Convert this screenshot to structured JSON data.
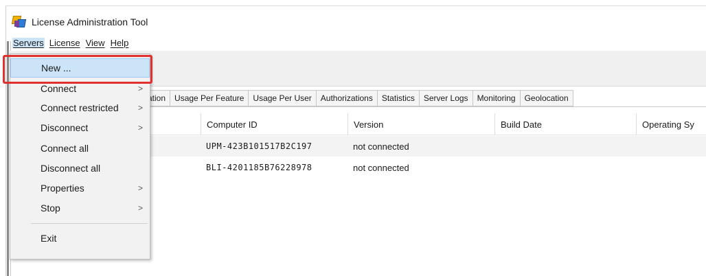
{
  "window": {
    "title": "License Administration Tool"
  },
  "menubar": {
    "items": [
      {
        "label": "Servers",
        "active": true
      },
      {
        "label": "License"
      },
      {
        "label": "View"
      },
      {
        "label": "Help"
      }
    ]
  },
  "servers_menu": {
    "items": [
      {
        "label": "New ...",
        "highlighted": true,
        "submenu": false
      },
      {
        "label": "Connect",
        "submenu": true
      },
      {
        "label": "Connect restricted",
        "submenu": true
      },
      {
        "label": "Disconnect",
        "submenu": true
      },
      {
        "label": "Connect all",
        "submenu": false
      },
      {
        "label": "Disconnect all",
        "submenu": false
      },
      {
        "label": "Properties",
        "submenu": true
      },
      {
        "label": "Stop",
        "submenu": true
      },
      {
        "label": "Exit",
        "submenu": false
      }
    ],
    "submenu_glyph": ">"
  },
  "tabs": [
    {
      "label": "ation"
    },
    {
      "label": "Usage Per Feature"
    },
    {
      "label": "Usage Per User"
    },
    {
      "label": "Authorizations"
    },
    {
      "label": "Statistics"
    },
    {
      "label": "Server Logs"
    },
    {
      "label": "Monitoring"
    },
    {
      "label": "Geolocation"
    }
  ],
  "table": {
    "columns": [
      "",
      "Computer ID",
      "Version",
      "Build Date",
      "Operating Sy"
    ],
    "rows": [
      {
        "computer_id": "UPM-423B101517B2C197",
        "version": "not connected"
      },
      {
        "computer_id": "BLI-4201185B76228978",
        "version": "not connected"
      }
    ]
  },
  "colors": {
    "highlight": "#cce4f7",
    "callout": "#e03030"
  }
}
